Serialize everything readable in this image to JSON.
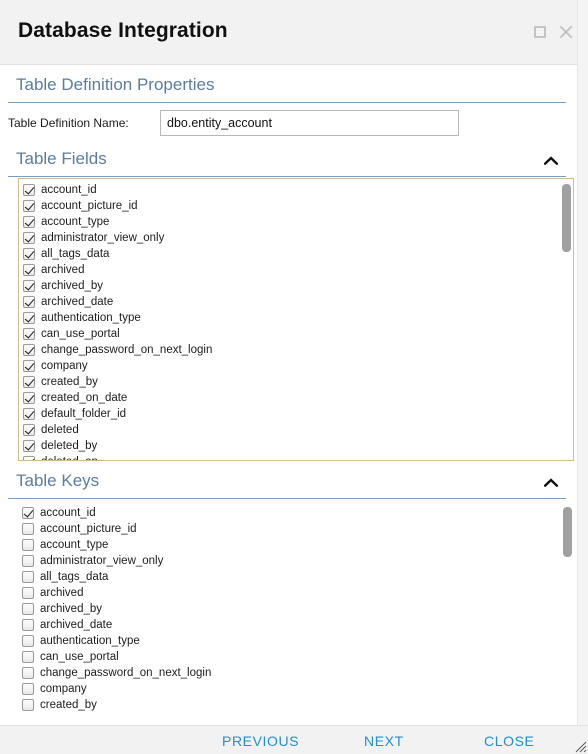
{
  "window": {
    "title": "Database Integration",
    "maximize_icon": "maximize-square-icon",
    "close_icon": "close-x-icon",
    "resize_icon": "resize-grip-icon"
  },
  "sections": {
    "properties": {
      "title": "Table Definition Properties",
      "field_label": "Table Definition Name:",
      "field_value": "dbo.entity_account",
      "field_placeholder": ""
    },
    "table_fields": {
      "title": "Table Fields",
      "collapse_icon": "chevron-up-icon",
      "items": [
        {
          "label": "account_id",
          "checked": true
        },
        {
          "label": "account_picture_id",
          "checked": true
        },
        {
          "label": "account_type",
          "checked": true
        },
        {
          "label": "administrator_view_only",
          "checked": true
        },
        {
          "label": "all_tags_data",
          "checked": true
        },
        {
          "label": "archived",
          "checked": true
        },
        {
          "label": "archived_by",
          "checked": true
        },
        {
          "label": "archived_date",
          "checked": true
        },
        {
          "label": "authentication_type",
          "checked": true
        },
        {
          "label": "can_use_portal",
          "checked": true
        },
        {
          "label": "change_password_on_next_login",
          "checked": true
        },
        {
          "label": "company",
          "checked": true
        },
        {
          "label": "created_by",
          "checked": true
        },
        {
          "label": "created_on_date",
          "checked": true
        },
        {
          "label": "default_folder_id",
          "checked": true
        },
        {
          "label": "deleted",
          "checked": true
        },
        {
          "label": "deleted_by",
          "checked": true
        },
        {
          "label": "deleted_on",
          "checked": true
        }
      ]
    },
    "table_keys": {
      "title": "Table Keys",
      "collapse_icon": "chevron-up-icon",
      "items": [
        {
          "label": "account_id",
          "checked": true
        },
        {
          "label": "account_picture_id",
          "checked": false
        },
        {
          "label": "account_type",
          "checked": false
        },
        {
          "label": "administrator_view_only",
          "checked": false
        },
        {
          "label": "all_tags_data",
          "checked": false
        },
        {
          "label": "archived",
          "checked": false
        },
        {
          "label": "archived_by",
          "checked": false
        },
        {
          "label": "archived_date",
          "checked": false
        },
        {
          "label": "authentication_type",
          "checked": false
        },
        {
          "label": "can_use_portal",
          "checked": false
        },
        {
          "label": "change_password_on_next_login",
          "checked": false
        },
        {
          "label": "company",
          "checked": false
        },
        {
          "label": "created_by",
          "checked": false
        }
      ]
    }
  },
  "footer": {
    "previous_label": "PREVIOUS",
    "next_label": "NEXT",
    "close_label": "CLOSE"
  },
  "colors": {
    "accent_link": "#2090d0",
    "section_heading": "#5c7d9e",
    "section_rule": "#7a9cc0",
    "listbox_border": "#d6b98c",
    "titlebar_bg": "#f2f2f2"
  }
}
